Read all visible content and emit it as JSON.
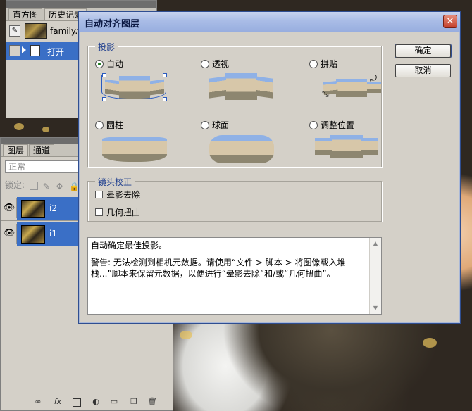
{
  "history_panel": {
    "tabs": [
      "直方图",
      "历史记录"
    ],
    "source_label": "family.tif",
    "open_step": "打开"
  },
  "layers_panel": {
    "tabs": [
      "图层",
      "通道"
    ],
    "blend_mode": "正常",
    "lock_label": "锁定:",
    "layers": [
      {
        "name": "i2"
      },
      {
        "name": "i1"
      }
    ],
    "bottom_icons": [
      "link-icon",
      "fx-icon",
      "mask-icon",
      "adjustment-icon",
      "folder-icon",
      "new-layer-icon",
      "trash-icon"
    ]
  },
  "dialog": {
    "title": "自动对齐图层",
    "close_glyph": "✕",
    "projection_legend": "投影",
    "projections": [
      {
        "label": "自动",
        "selected": true
      },
      {
        "label": "透视",
        "selected": false
      },
      {
        "label": "拼贴",
        "selected": false
      },
      {
        "label": "圆柱",
        "selected": false
      },
      {
        "label": "球面",
        "selected": false
      },
      {
        "label": "调整位置",
        "selected": false
      }
    ],
    "lens_legend": "镜头校正",
    "lens_options": [
      {
        "label": "晕影去除",
        "checked": false
      },
      {
        "label": "几何扭曲",
        "checked": false
      }
    ],
    "ok_label": "确定",
    "cancel_label": "取消",
    "description": [
      "自动确定最佳投影。",
      "警告: 无法检测到相机元数据。请使用“文件 > 脚本 > 将图像载入堆栈...”脚本来保留元数据，以便进行“晕影去除”和/或“几何扭曲”。"
    ]
  },
  "colors": {
    "accent": "#3a6fc6",
    "title_text": "#0d1a44",
    "legend_text": "#1f3f8f",
    "panel_bg": "#d4d0c8"
  }
}
